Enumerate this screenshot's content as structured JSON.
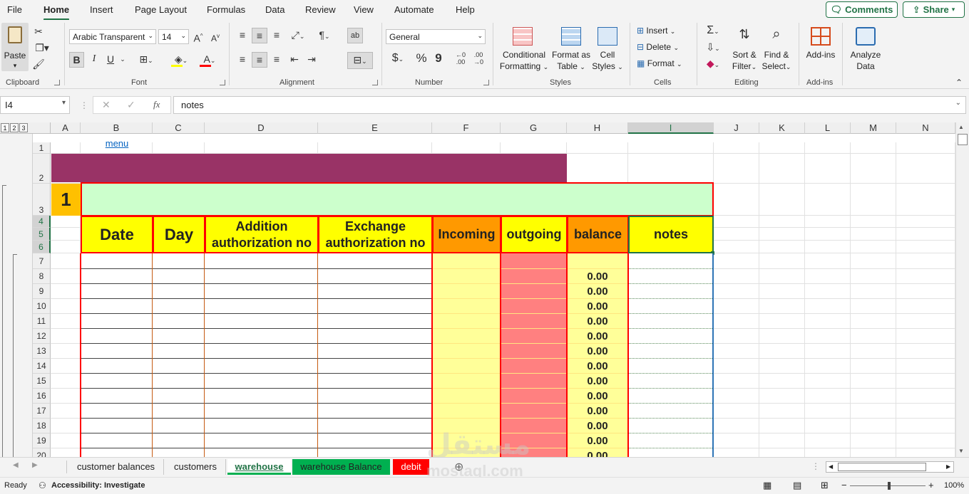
{
  "menu": {
    "tabs": [
      "File",
      "Home",
      "Insert",
      "Page Layout",
      "Formulas",
      "Data",
      "Review",
      "View",
      "Automate",
      "Help"
    ],
    "comments_label": "Comments",
    "share_label": "Share"
  },
  "ribbon": {
    "clipboard": {
      "paste": "Paste",
      "label": "Clipboard"
    },
    "font": {
      "name": "Arabic Transparent",
      "size": "14",
      "label": "Font",
      "bold": "B",
      "italic": "I",
      "underline": "U"
    },
    "alignment": {
      "label": "Alignment"
    },
    "number": {
      "format": "General",
      "label": "Number",
      "currency": "$",
      "percent": "%",
      "comma": "9"
    },
    "styles": {
      "conditional": [
        "Conditional",
        "Formatting"
      ],
      "format_table": [
        "Format as",
        "Table"
      ],
      "cell_styles": [
        "Cell",
        "Styles"
      ],
      "label": "Styles"
    },
    "cells": {
      "insert": "Insert",
      "delete": "Delete",
      "format": "Format",
      "label": "Cells"
    },
    "editing": {
      "sort": [
        "Sort &",
        "Filter"
      ],
      "find": [
        "Find &",
        "Select"
      ],
      "label": "Editing"
    },
    "addins": {
      "button": "Add-ins",
      "label": "Add-ins"
    },
    "analyze": {
      "button": [
        "Analyze",
        "Data"
      ]
    }
  },
  "formula_bar": {
    "name_box": "I4",
    "content": "notes",
    "fx": "fx"
  },
  "outline_levels": [
    "1",
    "2",
    "3"
  ],
  "columns": [
    "A",
    "B",
    "C",
    "D",
    "E",
    "F",
    "G",
    "H",
    "I",
    "J",
    "K",
    "L",
    "M",
    "N"
  ],
  "rows": [
    "1",
    "2",
    "3",
    "4",
    "5",
    "6",
    "7",
    "8",
    "9",
    "10",
    "11",
    "12",
    "13",
    "14",
    "15",
    "16",
    "17",
    "18",
    "19",
    "20"
  ],
  "sheet": {
    "menu_link": "menu",
    "number_badge": "1",
    "headers": {
      "date": "Date",
      "day": "Day",
      "addition": [
        "Addition",
        "authorization no"
      ],
      "exchange": [
        "Exchange",
        "authorization no"
      ],
      "incoming": "Incoming",
      "outgoing": "outgoing",
      "balance": "balance",
      "notes": "notes"
    },
    "balances": [
      "0.00",
      "0.00",
      "0.00",
      "0.00",
      "0.00",
      "0.00",
      "0.00",
      "0.00",
      "0.00",
      "0.00",
      "0.00",
      "0.00",
      "0.00"
    ]
  },
  "sheet_tabs": [
    {
      "label": "customer balances",
      "color": ""
    },
    {
      "label": "customers",
      "color": ""
    },
    {
      "label": "warehouse",
      "color": "#00b050",
      "active": true
    },
    {
      "label": "warehouse Balance",
      "color": "#00b050"
    },
    {
      "label": "debit",
      "color": "#ff0000"
    }
  ],
  "status": {
    "ready": "Ready",
    "accessibility": "Accessibility: Investigate",
    "zoom": "100%"
  },
  "watermark": {
    "arabic": "مستقل",
    "latin": "mostaql.com"
  },
  "colors": {
    "accent": "#217346",
    "purple": "#993366",
    "light_green": "#ccffcc",
    "yellow": "#ffff00",
    "orange": "#ff9900",
    "light_yellow": "#ffff99",
    "salmon": "#ff8080",
    "red_border": "#ff0000"
  }
}
